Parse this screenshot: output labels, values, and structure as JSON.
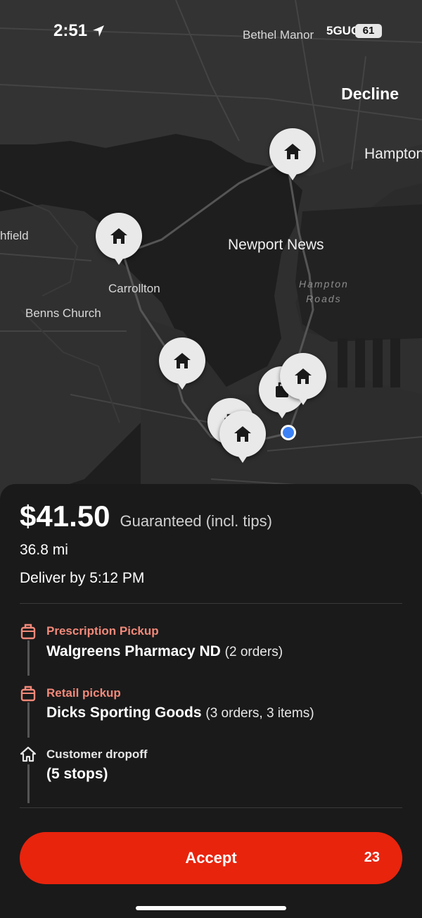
{
  "status_bar": {
    "time": "2:51",
    "signal": "5GUC",
    "battery": "61"
  },
  "map": {
    "decline_label": "Decline",
    "labels": {
      "bethel_manor": "Bethel Manor",
      "hampton": "Hampton",
      "smithfield": "hfield",
      "newport_news": "Newport News",
      "carrollton": "Carrollton",
      "benns_church": "Benns Church",
      "hampton_roads_1": "Hampton",
      "hampton_roads_2": "Roads"
    }
  },
  "offer": {
    "price": "$41.50",
    "guaranteed": "Guaranteed (incl. tips)",
    "distance": "36.8 mi",
    "deliver_by": "Deliver by 5:12 PM"
  },
  "stops": [
    {
      "kind": "Prescription Pickup",
      "name": "Walgreens Pharmacy ND",
      "detail": "(2 orders)",
      "icon": "shopping-bag-icon"
    },
    {
      "kind": "Retail pickup",
      "name": "Dicks Sporting Goods",
      "detail": "(3 orders, 3 items)",
      "icon": "shopping-bag-icon"
    },
    {
      "kind": "Customer dropoff",
      "name": "(5 stops)",
      "detail": "",
      "icon": "home-icon"
    }
  ],
  "accept": {
    "label": "Accept",
    "countdown": "23"
  },
  "colors": {
    "accent": "#e8240d",
    "pickup_label": "#f2897a",
    "user_location": "#3c82f6"
  }
}
